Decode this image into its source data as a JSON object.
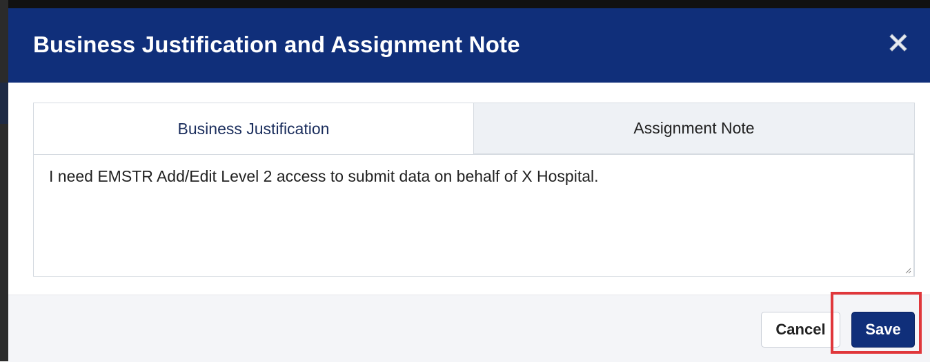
{
  "modal": {
    "title": "Business Justification and Assignment Note",
    "close_icon": "close-icon"
  },
  "tabs": [
    {
      "label": "Business Justification",
      "active": true
    },
    {
      "label": "Assignment Note",
      "active": false
    }
  ],
  "business_justification": {
    "value": "I need EMSTR Add/Edit Level 2 access to submit data on behalf of X Hospital."
  },
  "footer": {
    "cancel_label": "Cancel",
    "save_label": "Save"
  },
  "colors": {
    "header_bg": "#102f7a",
    "primary_button": "#102f7a",
    "highlight": "#e0373b"
  }
}
